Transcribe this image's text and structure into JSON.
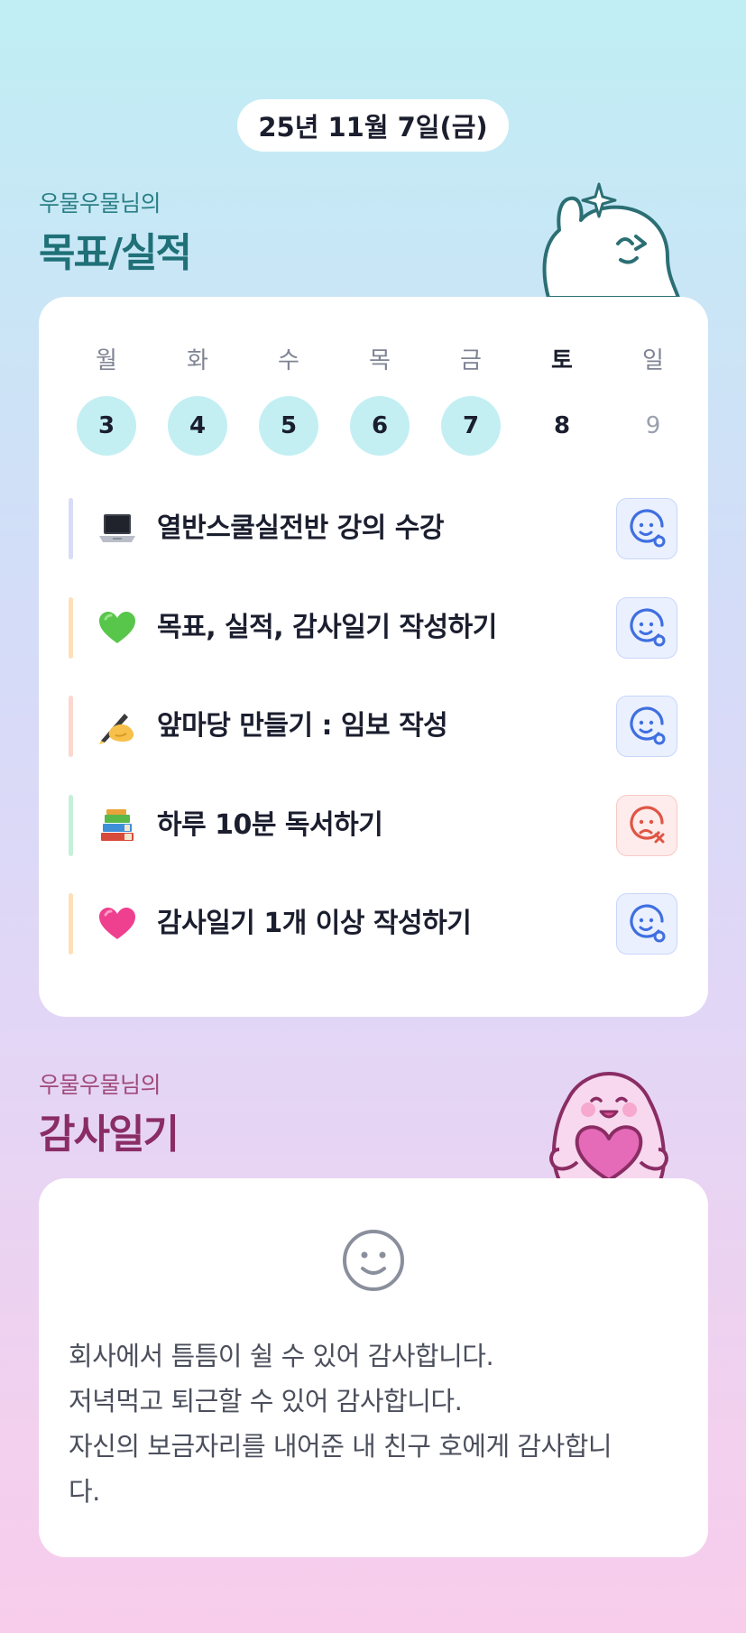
{
  "header": {
    "date": "25년 11월 7일(금)"
  },
  "goals_section": {
    "owner": "우물우물님의",
    "title": "목표/실적"
  },
  "week": {
    "days": [
      "월",
      "화",
      "수",
      "목",
      "금",
      "토",
      "일"
    ],
    "dates": [
      "3",
      "4",
      "5",
      "6",
      "7",
      "8",
      "9"
    ]
  },
  "goals": [
    {
      "emoji": "laptop-icon",
      "text": "열반스쿨실전반 강의 수강",
      "bar_color": "#d8dcf6",
      "status": "done"
    },
    {
      "emoji": "green-heart-icon",
      "text": "목표, 실적, 감사일기 작성하기",
      "bar_color": "#fde0b8",
      "status": "done"
    },
    {
      "emoji": "writing-hand-icon",
      "text": "앞마당 만들기 : 임보 작성",
      "bar_color": "#fbd7d0",
      "status": "done"
    },
    {
      "emoji": "books-icon",
      "text": "하루 10분 독서하기",
      "bar_color": "#c5f0d8",
      "status": "fail"
    },
    {
      "emoji": "pink-heart-icon",
      "text": "감사일기 1개 이상 작성하기",
      "bar_color": "#fde0b8",
      "status": "done"
    }
  ],
  "diary_section": {
    "owner": "우물우물님의",
    "title": "감사일기"
  },
  "diary": {
    "icon": "smile-face-icon",
    "lines": [
      "회사에서 틈틈이 쉴 수 있어 감사합니다.",
      "저녁먹고 퇴근할 수 있어 감사합니다.",
      "자신의 보금자리를 내어준 내 친구 호에게 감사합니",
      "다."
    ]
  },
  "colors": {
    "accent_teal": "#1f7077",
    "accent_pink": "#8a2d64",
    "done_blue": "#3f6fe0",
    "fail_red": "#e05545",
    "date_circle": "#c3eff3"
  }
}
